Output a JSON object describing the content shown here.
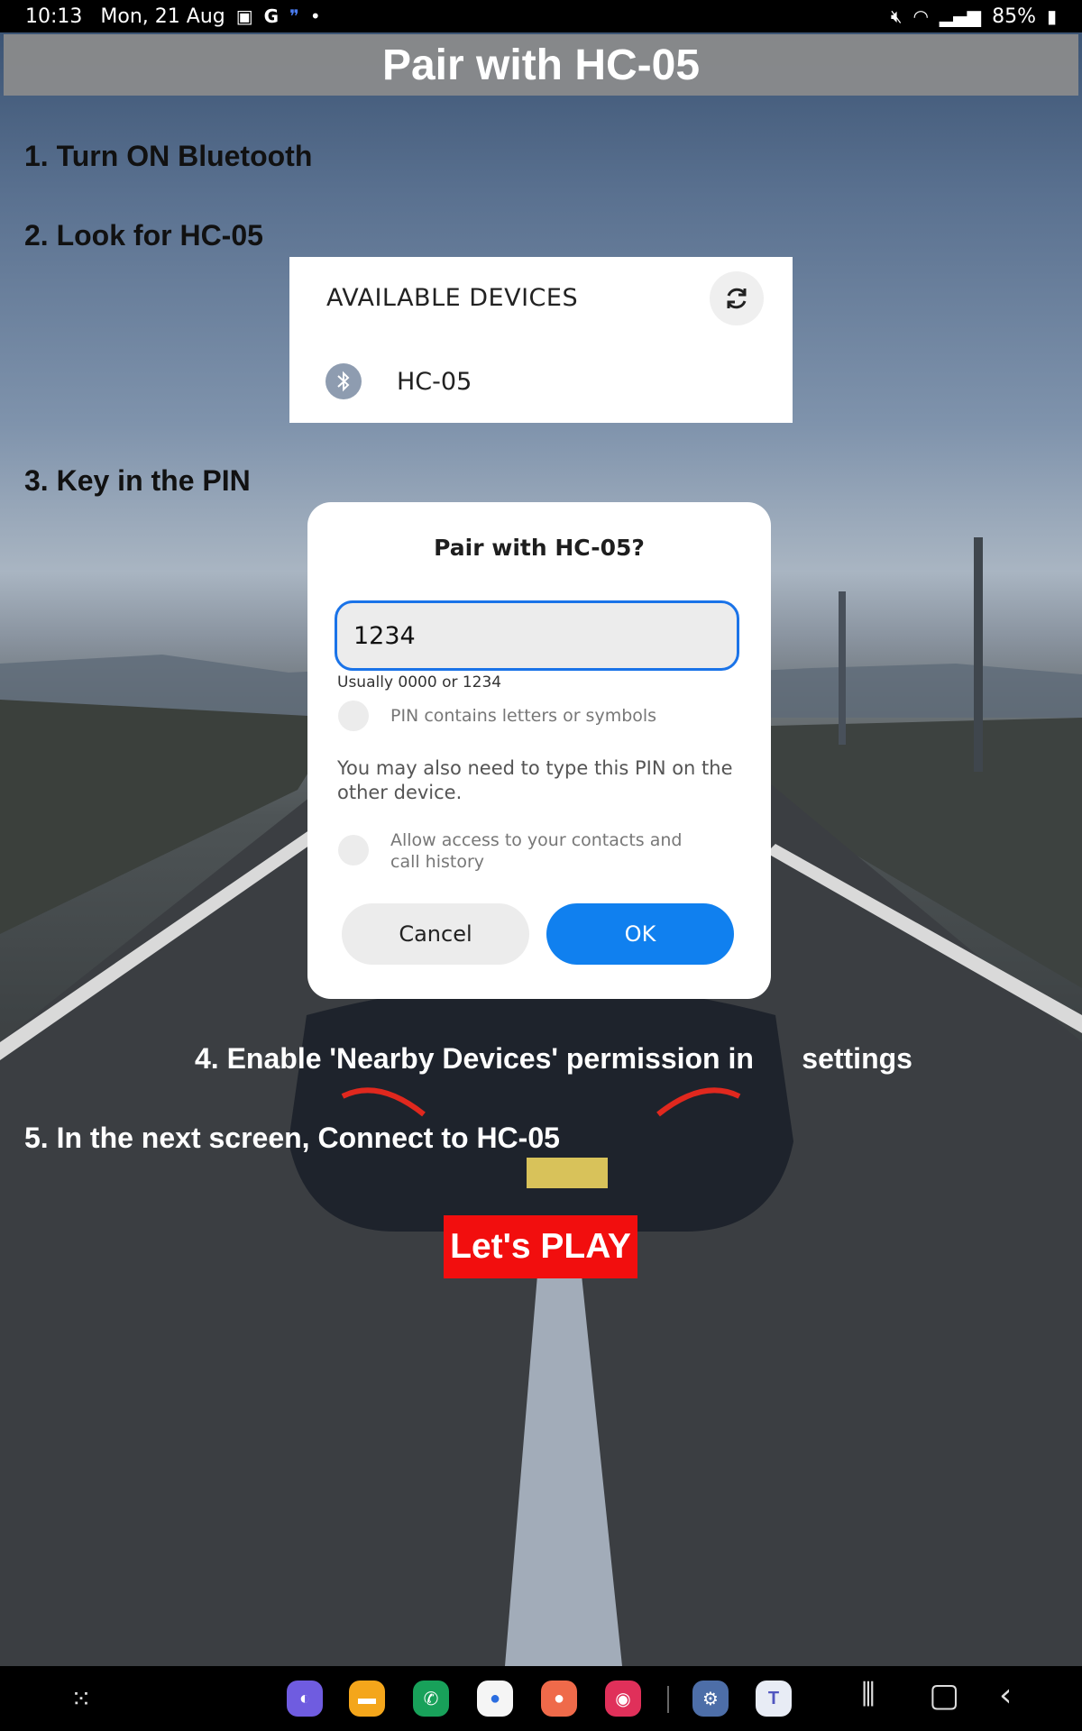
{
  "status_bar": {
    "time": "10:13",
    "date": "Mon, 21 Aug",
    "battery": "85%",
    "left_icons": [
      "gallery-icon",
      "google-icon",
      "quote-icon",
      "dot-icon"
    ],
    "right_icons": [
      "mute-icon",
      "wifi-icon",
      "signal-icon",
      "battery-icon"
    ]
  },
  "page": {
    "title": "Pair with HC-05",
    "steps": [
      "1. Turn ON Bluetooth",
      "2. Look for HC-05",
      "3. Key in the PIN",
      "4. Enable 'Nearby Devices' permission in      settings",
      "5. In the next screen, Connect to HC-05"
    ],
    "play_label": "Let's PLAY"
  },
  "devices_card": {
    "header": "AVAILABLE DEVICES",
    "device_name": "HC-05"
  },
  "dialog": {
    "title": "Pair with HC-05?",
    "pin_value": "1234",
    "pin_hint": "Usually 0000 or 1234",
    "pin_letters_label": "PIN contains letters or symbols",
    "note": "You may also need to type this PIN on the other device.",
    "contacts_label": "Allow access to your contacts and call history",
    "cancel_label": "Cancel",
    "ok_label": "OK"
  },
  "nav_bar": {
    "apps": [
      "apps-grid-icon",
      "internet-icon",
      "files-icon",
      "phone-icon",
      "messages-icon",
      "contacts-icon",
      "screen-recorder-icon",
      "settings-icon",
      "teams-icon"
    ],
    "buttons": [
      "recents-icon",
      "home-icon",
      "back-icon"
    ]
  },
  "colors": {
    "accent_blue": "#1080ef",
    "play_red": "#f20e0e",
    "title_bar_gray": "#8c8c8c"
  }
}
